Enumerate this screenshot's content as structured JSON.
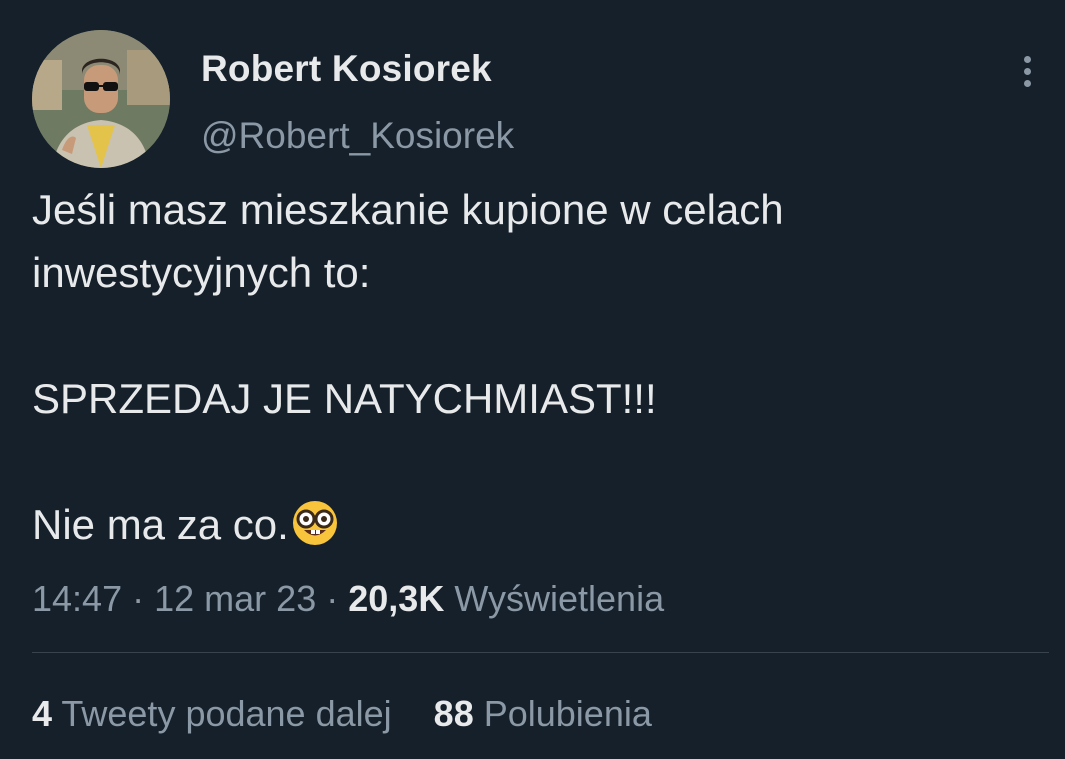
{
  "author": {
    "display_name": "Robert Kosiorek",
    "handle": "@Robert_Kosiorek",
    "avatar_icon": "profile-photo"
  },
  "menu": {
    "icon": "more-vertical-icon"
  },
  "tweet": {
    "lines": [
      "Jeśli masz mieszkanie kupione w celach",
      "inwestycyjnych to:",
      "SPRZEDAJ JE NATYCHMIAST!!!",
      "Nie ma za co."
    ],
    "emoji": "nerd-face-emoji"
  },
  "meta": {
    "time": "14:47",
    "separator": "·",
    "date": "12 mar 23",
    "views_count": "20,3K",
    "views_label": "Wyświetlenia"
  },
  "stats": {
    "retweets_count": "4",
    "retweets_label": "Tweety podane dalej",
    "likes_count": "88",
    "likes_label": "Polubienia"
  },
  "colors": {
    "background": "#15202b",
    "primary_text": "#e7e9ea",
    "secondary_text": "#8b98a5",
    "divider": "#38444d"
  }
}
